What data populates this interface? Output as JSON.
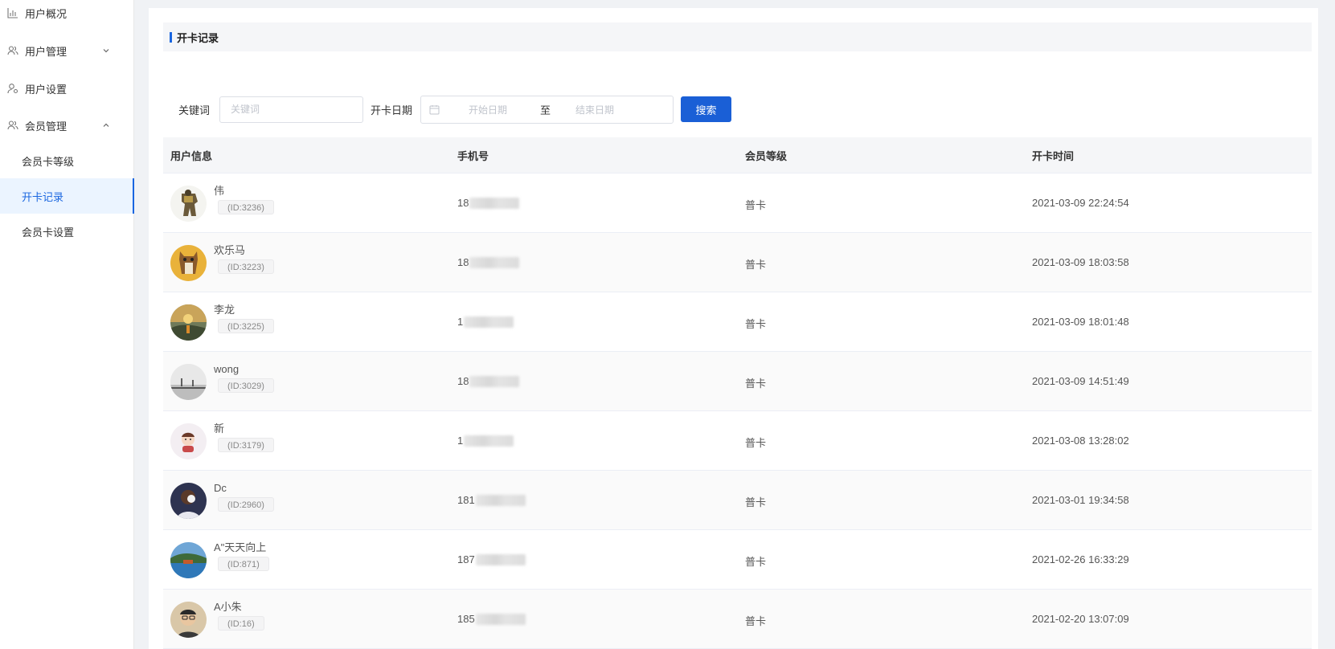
{
  "sidebar": {
    "items": [
      {
        "label": "用户概况",
        "icon": "bar-chart-icon"
      },
      {
        "label": "用户管理",
        "icon": "users-icon",
        "expanded": false
      },
      {
        "label": "用户设置",
        "icon": "user-settings-icon"
      },
      {
        "label": "会员管理",
        "icon": "users-icon",
        "expanded": true
      }
    ],
    "sub_items": [
      {
        "label": "会员卡等级",
        "active": false
      },
      {
        "label": "开卡记录",
        "active": true
      },
      {
        "label": "会员卡设置",
        "active": false
      }
    ]
  },
  "page": {
    "title": "开卡记录"
  },
  "filter": {
    "keyword_label": "关键词",
    "keyword_placeholder": "关键词",
    "keyword_value": "",
    "date_label": "开卡日期",
    "start_placeholder": "开始日期",
    "separator": "至",
    "end_placeholder": "结束日期",
    "search_label": "搜索"
  },
  "table": {
    "headers": [
      "用户信息",
      "手机号",
      "会员等级",
      "开卡时间"
    ],
    "rows": [
      {
        "name": "伟",
        "id": "(ID:3236)",
        "phone_prefix": "18",
        "level": "普卡",
        "time": "2021-03-09 22:24:54",
        "avatar": "robot-avatar"
      },
      {
        "name": "欢乐马",
        "id": "(ID:3223)",
        "phone_prefix": "18",
        "level": "普卡",
        "time": "2021-03-09 18:03:58",
        "avatar": "horse-avatar"
      },
      {
        "name": "李龙",
        "id": "(ID:3225)",
        "phone_prefix": "1",
        "level": "普卡",
        "time": "2021-03-09 18:01:48",
        "avatar": "sunset-avatar"
      },
      {
        "name": "wong",
        "id": "(ID:3029)",
        "phone_prefix": "18",
        "level": "普卡",
        "time": "2021-03-09 14:51:49",
        "avatar": "landscape-avatar"
      },
      {
        "name": "新",
        "id": "(ID:3179)",
        "phone_prefix": "1",
        "level": "普卡",
        "time": "2021-03-08 13:28:02",
        "avatar": "cartoon-avatar"
      },
      {
        "name": "Dc",
        "id": "(ID:2960)",
        "phone_prefix": "181",
        "level": "普卡",
        "time": "2021-03-01 19:34:58",
        "avatar": "dark-avatar"
      },
      {
        "name": "A\"天天向上",
        "id": "(ID:871)",
        "phone_prefix": "187",
        "level": "普卡",
        "time": "2021-02-26 16:33:29",
        "avatar": "lake-avatar"
      },
      {
        "name": "A小朱",
        "id": "(ID:16)",
        "phone_prefix": "185",
        "level": "普卡",
        "time": "2021-02-20 13:07:09",
        "avatar": "person-avatar"
      }
    ]
  },
  "colors": {
    "accent": "#1a66e0",
    "button": "#1a5fd6",
    "header_bg": "#f5f6f8"
  }
}
